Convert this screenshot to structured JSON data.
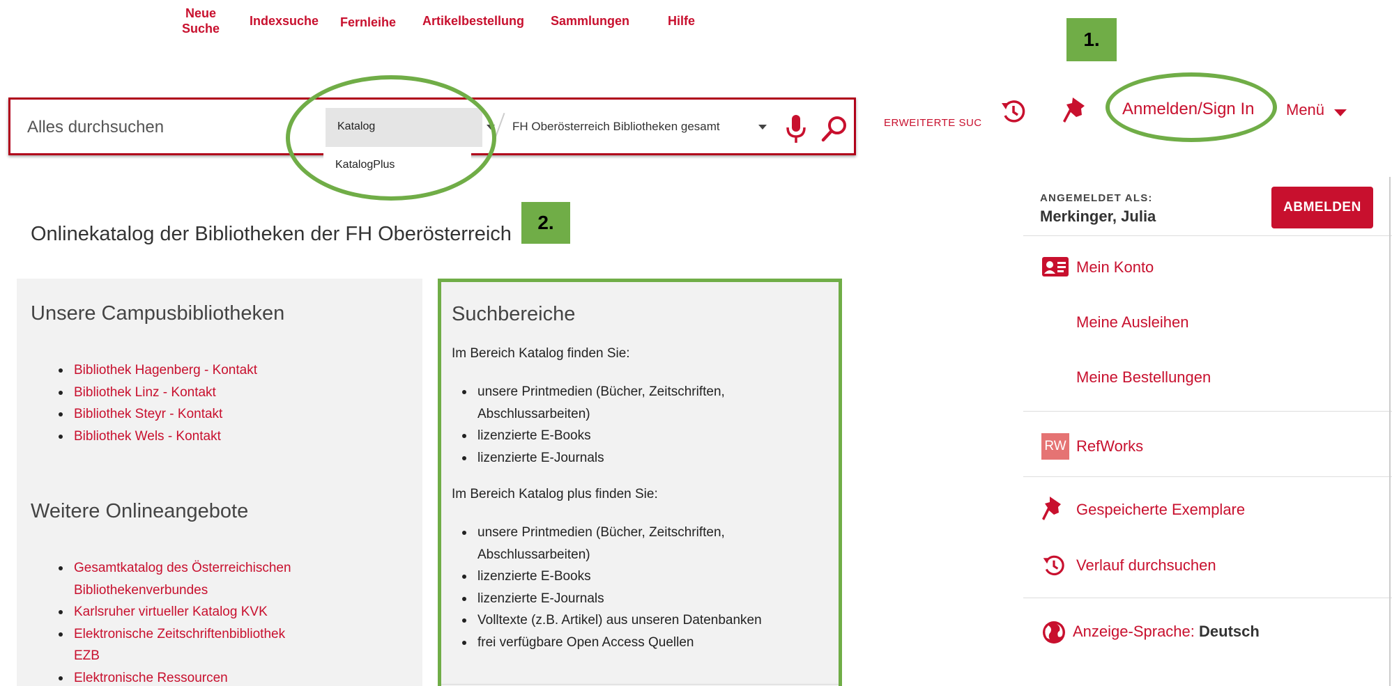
{
  "nav": {
    "items": [
      {
        "label_line1": "Neue",
        "label_line2": "Suche"
      },
      {
        "label": "Indexsuche"
      },
      {
        "label": "Fernleihe"
      },
      {
        "label": "Artikelbestellung"
      },
      {
        "label": "Sammlungen"
      },
      {
        "label": "Hilfe"
      }
    ]
  },
  "search": {
    "placeholder": "Alles durchsuchen",
    "scope_selected": "Katalog",
    "scope_option": "KatalogPlus",
    "library_selected": "FH Oberösterreich Bibliotheken gesamt",
    "advanced_label": "ERWEITERTE SUC"
  },
  "header": {
    "signin_label": "Anmelden/Sign In",
    "menu_label": "Menü"
  },
  "annotations": {
    "badge_1": "1.",
    "badge_2": "2."
  },
  "page": {
    "title": "Onlinekatalog der Bibliotheken der FH Oberösterreich"
  },
  "campus": {
    "heading": "Unsere Campusbibliotheken",
    "links": [
      "Bibliothek Hagenberg - Kontakt",
      "Bibliothek Linz - Kontakt",
      "Bibliothek Steyr - Kontakt",
      "Bibliothek Wels - Kontakt"
    ]
  },
  "online": {
    "heading": "Weitere Onlineangebote",
    "links": [
      "Gesamtkatalog des Österreichischen Bibliothekenverbundes",
      "Karlsruher virtueller Katalog KVK",
      "Elektronische Zeitschriftenbibliothek EZB",
      "Elektronische Ressourcen"
    ]
  },
  "suchbereiche": {
    "heading": "Suchbereiche",
    "katalog_intro": "Im Bereich Katalog finden Sie:",
    "katalog_items": [
      "unsere Printmedien (Bücher, Zeitschriften, Abschlussarbeiten)",
      "lizenzierte E-Books",
      "lizenzierte E-Journals"
    ],
    "plus_intro": "Im Bereich Katalog plus finden Sie:",
    "plus_items": [
      "unsere Printmedien (Bücher, Zeitschriften, Abschlussarbeiten)",
      "lizenzierte E-Books",
      "lizenzierte E-Journals",
      "Volltexte (z.B. Artikel) aus unseren Datenbanken",
      "frei verfügbare Open Access Quellen"
    ]
  },
  "account": {
    "logged_in_label": "ANGEMELDET ALS:",
    "user_name": "Merkinger, Julia",
    "logout_label": "ABMELDEN",
    "my_account": "Mein Konto",
    "my_loans": "Meine Ausleihen",
    "my_orders": "Meine Bestellungen",
    "refworks": "RefWorks",
    "refworks_icon_text": "RW",
    "saved_items": "Gespeicherte Exemplare",
    "search_history": "Verlauf durchsuchen",
    "language_label": "Anzeige-Sprache:",
    "language_value": "Deutsch"
  },
  "colors": {
    "brand_red": "#c8102e",
    "highlight_green": "#70ad47"
  },
  "icons": [
    "microphone-icon",
    "search-icon",
    "history-icon",
    "pin-icon",
    "id-card-icon",
    "globe-icon"
  ]
}
